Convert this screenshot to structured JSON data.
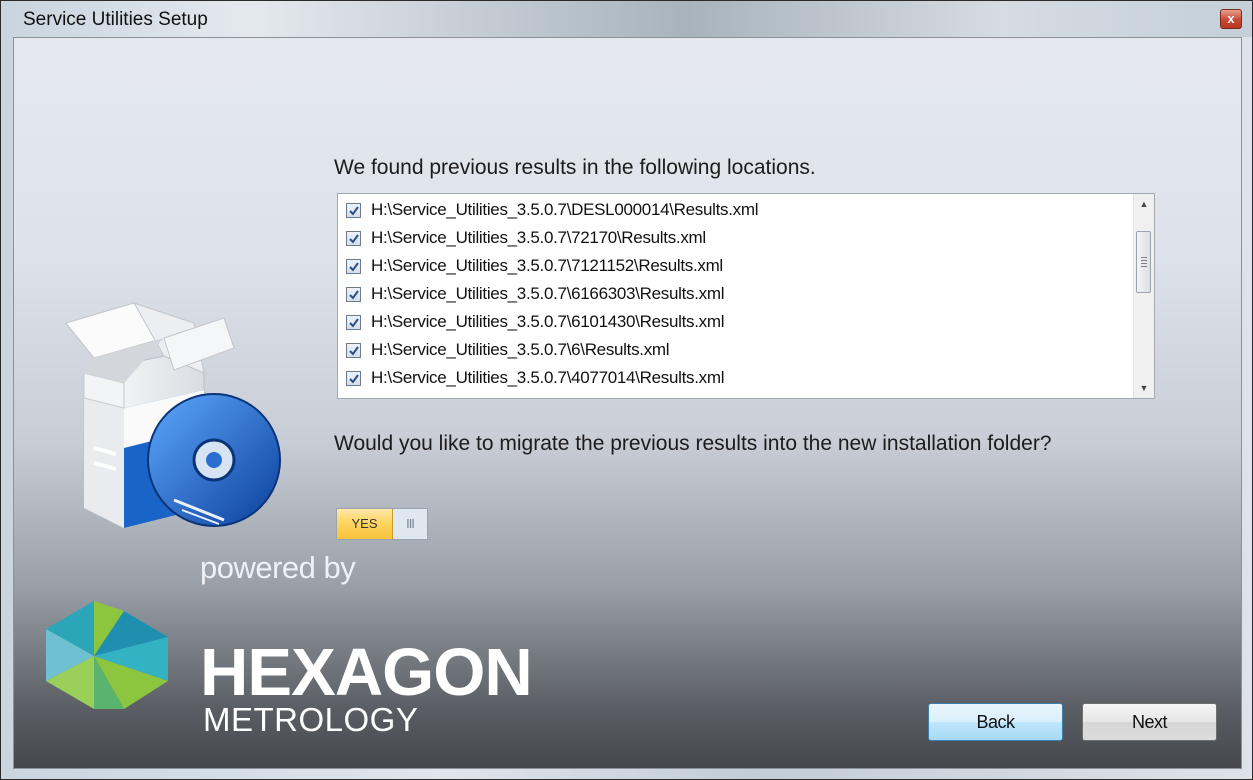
{
  "window": {
    "title": "Service Utilities Setup",
    "close_label": "x"
  },
  "main": {
    "found_text": "We found previous results in the following locations.",
    "results": [
      {
        "path": "H:\\Service_Utilities_3.5.0.7\\DESL000014\\Results.xml",
        "checked": true
      },
      {
        "path": "H:\\Service_Utilities_3.5.0.7\\72170\\Results.xml",
        "checked": true
      },
      {
        "path": "H:\\Service_Utilities_3.5.0.7\\7121152\\Results.xml",
        "checked": true
      },
      {
        "path": "H:\\Service_Utilities_3.5.0.7\\6166303\\Results.xml",
        "checked": true
      },
      {
        "path": "H:\\Service_Utilities_3.5.0.7\\6101430\\Results.xml",
        "checked": true
      },
      {
        "path": "H:\\Service_Utilities_3.5.0.7\\6\\Results.xml",
        "checked": true
      },
      {
        "path": "H:\\Service_Utilities_3.5.0.7\\4077014\\Results.xml",
        "checked": true
      }
    ],
    "question_text": "Would you like to migrate the previous results into the new installation folder?",
    "toggle": {
      "label": "YES",
      "handle": "III",
      "value": true
    }
  },
  "branding": {
    "powered_by": "powered by",
    "name": "HEXAGON",
    "subname": "METROLOGY"
  },
  "buttons": {
    "back_label": "Back",
    "next_label": "Next"
  },
  "colors": {
    "toggle_on": "#ffd35c",
    "logo_teal": "#2aa6b8",
    "logo_green": "#8cc63f",
    "back_focus": "#3c7fb1"
  }
}
